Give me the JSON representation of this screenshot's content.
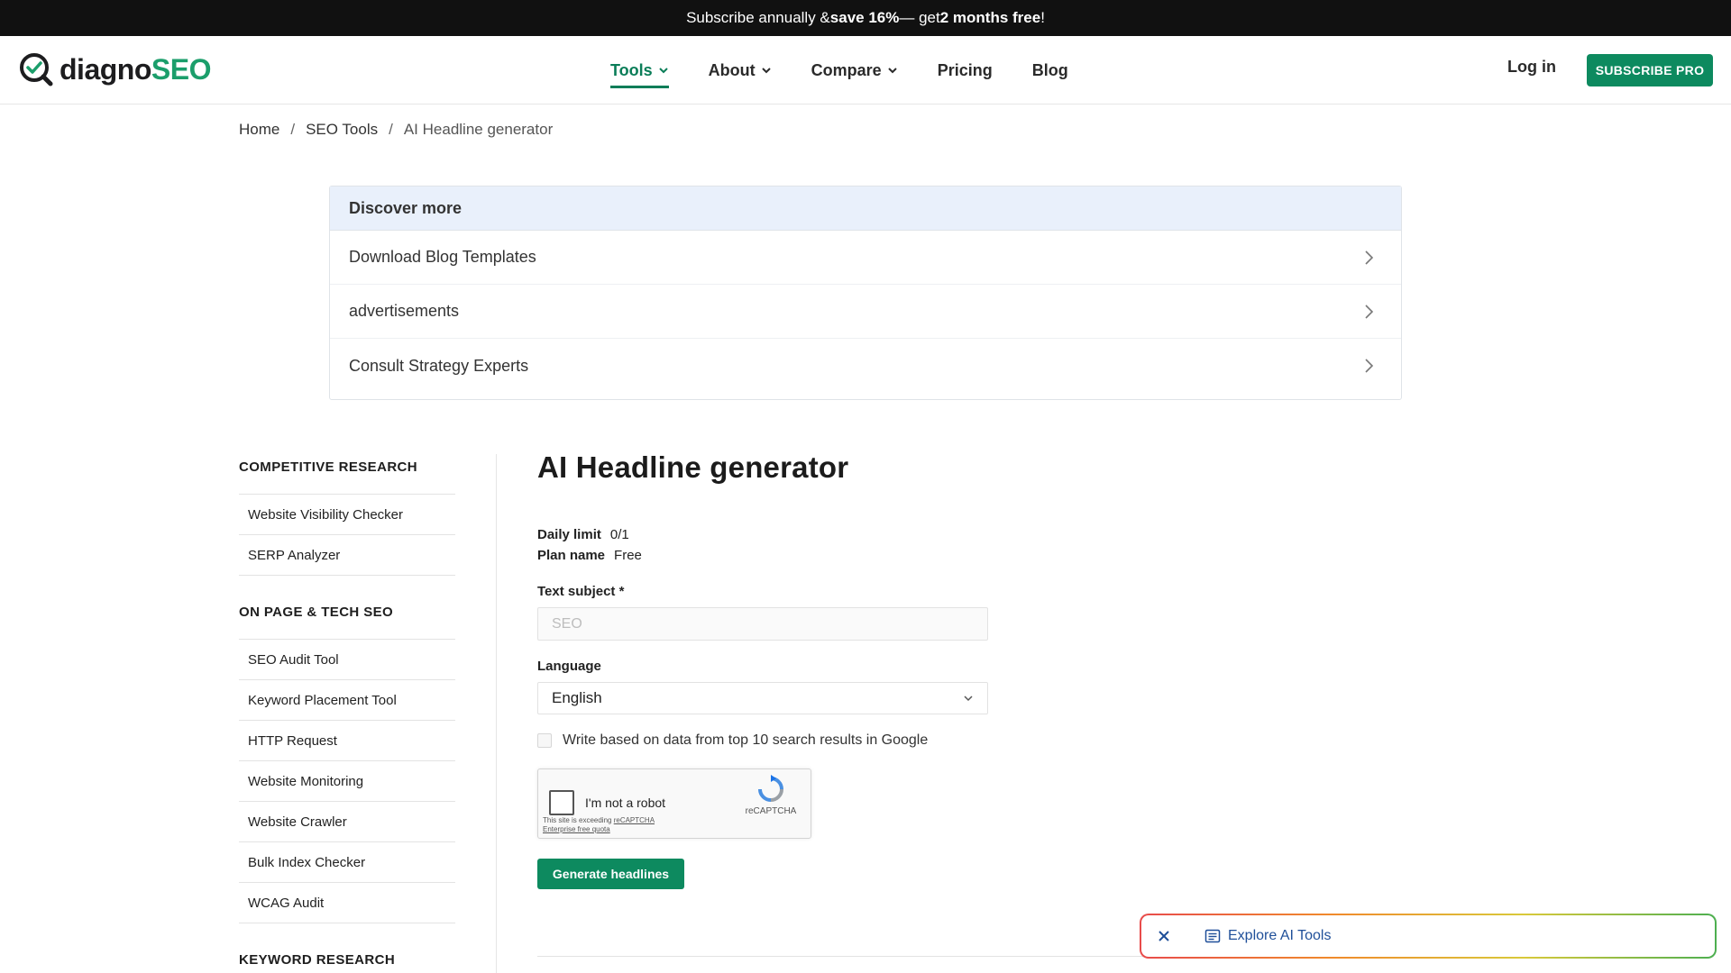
{
  "promo": {
    "part1": "Subscribe annually & ",
    "bold1": "save 16%",
    "part2": " — get ",
    "bold2": "2 months free",
    "part3": "!"
  },
  "header": {
    "logo_main": "diagno",
    "logo_accent": "SEO",
    "nav": [
      {
        "label": "Tools",
        "dropdown": true,
        "active": true
      },
      {
        "label": "About",
        "dropdown": true
      },
      {
        "label": "Compare",
        "dropdown": true
      },
      {
        "label": "Pricing"
      },
      {
        "label": "Blog"
      }
    ],
    "login": "Log in",
    "subscribe": "SUBSCRIBE PRO"
  },
  "breadcrumb": {
    "home": "Home",
    "sep": "/",
    "tools": "SEO Tools",
    "current": "AI Headline generator"
  },
  "discover": {
    "heading": "Discover more",
    "items": [
      "Download Blog Templates",
      "advertisements",
      "Consult Strategy Experts"
    ]
  },
  "sidebar": {
    "sections": [
      {
        "heading": "COMPETITIVE RESEARCH",
        "items": [
          "Website Visibility Checker",
          "SERP Analyzer"
        ]
      },
      {
        "heading": "ON PAGE & TECH SEO",
        "items": [
          "SEO Audit Tool",
          "Keyword Placement Tool",
          "HTTP Request",
          "Website Monitoring",
          "Website Crawler",
          "Bulk Index Checker",
          "WCAG Audit"
        ]
      },
      {
        "heading": "KEYWORD RESEARCH",
        "items": []
      }
    ]
  },
  "main": {
    "title": "AI Headline generator",
    "daily_limit_label": "Daily limit",
    "daily_limit_value": "0/1",
    "plan_label": "Plan name",
    "plan_value": "Free",
    "subject_label": "Text subject *",
    "subject_placeholder": "SEO",
    "language_label": "Language",
    "language_value": "English",
    "checkbox_label": "Write based on data from top 10 search results in Google",
    "captcha_label": "I'm not a robot",
    "captcha_note1": "This site is exceeding ",
    "captcha_link": "reCAPTCHA",
    "captcha_note2": "Enterprise free quota",
    "captcha_brand": "reCAPTCHA",
    "generate_button": "Generate headlines"
  },
  "explore": {
    "label": "Explore AI Tools"
  },
  "colors": {
    "brand_green": "#0d8a5f",
    "discover_header_bg": "#e9f0fb",
    "explore_link": "#1f4f99"
  }
}
